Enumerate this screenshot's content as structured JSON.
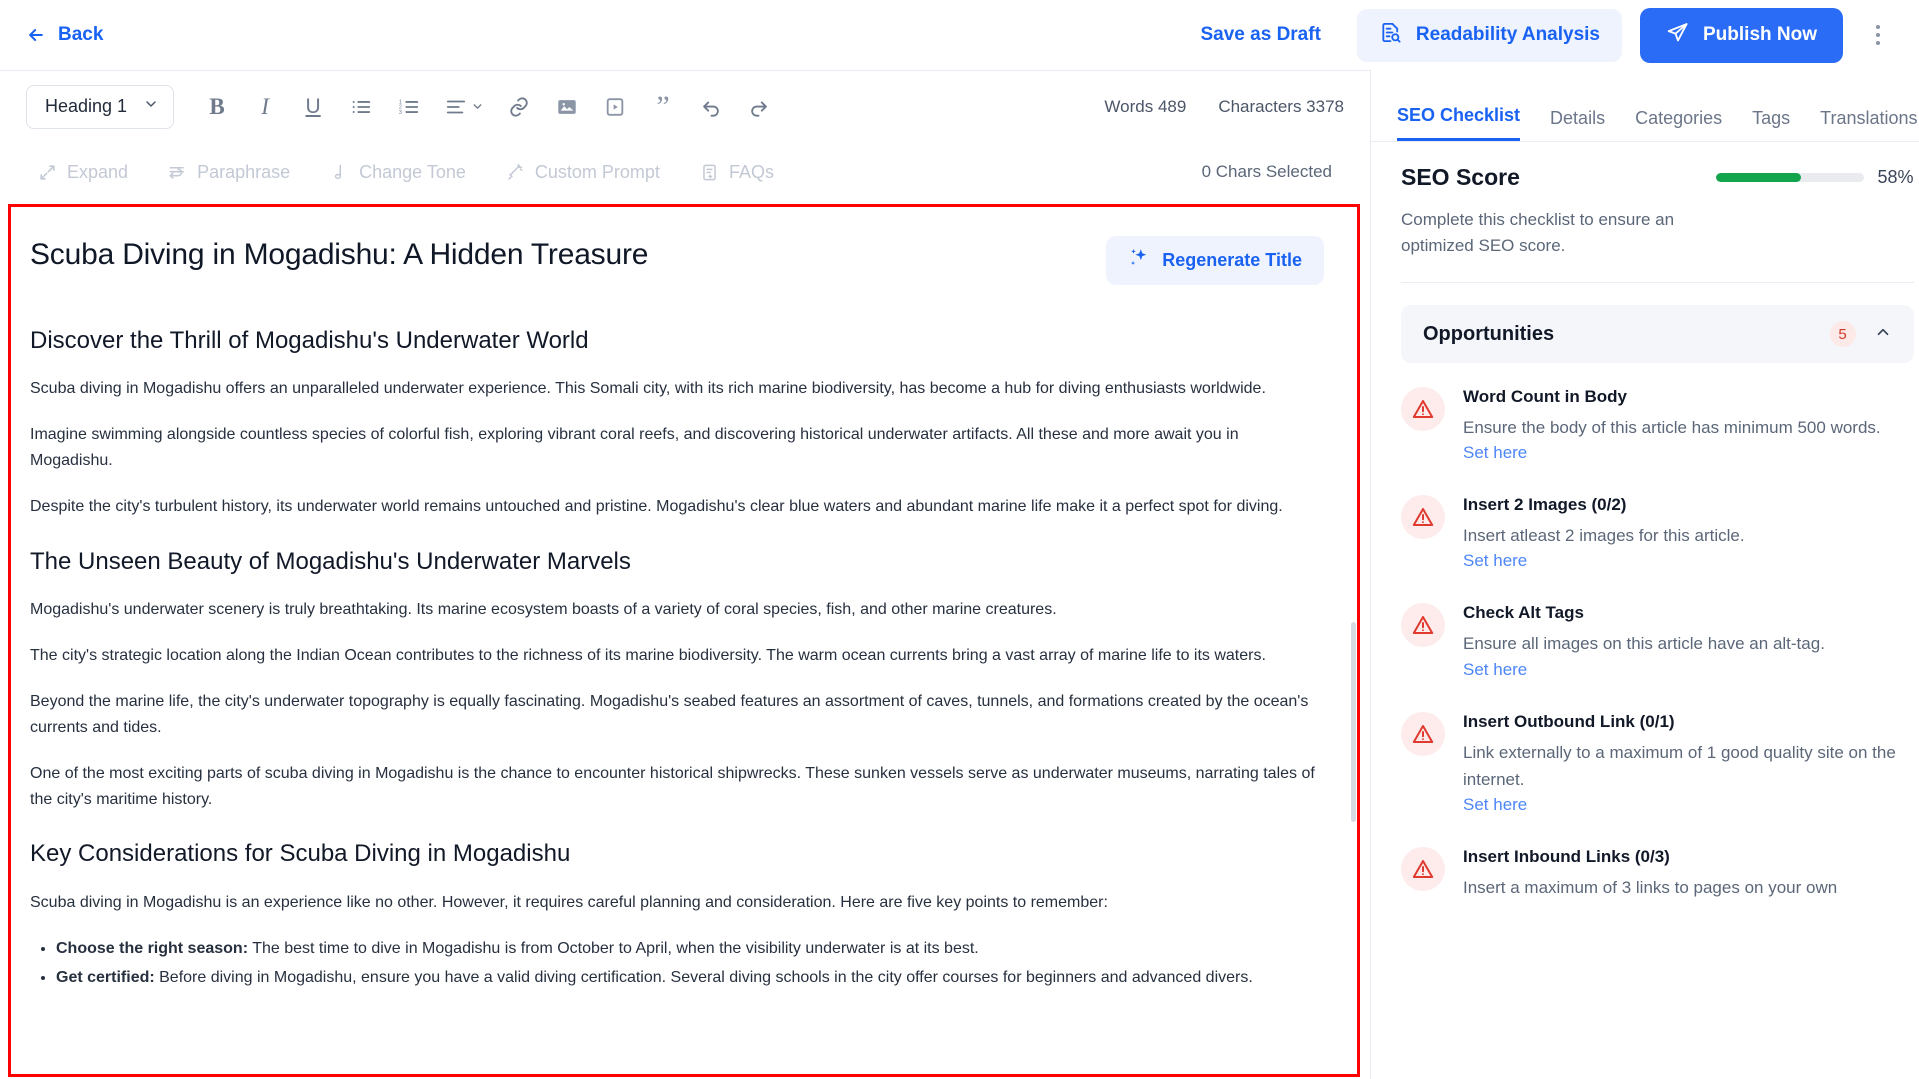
{
  "topbar": {
    "back_label": "Back",
    "save_draft_label": "Save as Draft",
    "readability_label": "Readability Analysis",
    "publish_label": "Publish Now"
  },
  "format_toolbar": {
    "heading_value": "Heading 1",
    "counts": {
      "words": "Words 489",
      "characters": "Characters 3378"
    },
    "buttons": [
      {
        "name": "bold-button",
        "label": "B"
      },
      {
        "name": "italic-button",
        "label": "I"
      },
      {
        "name": "underline-button",
        "label": "U"
      },
      {
        "name": "bullet-list-button",
        "label": "Bullet list"
      },
      {
        "name": "numbered-list-button",
        "label": "Numbered list"
      },
      {
        "name": "align-button",
        "label": "Align"
      },
      {
        "name": "link-button",
        "label": "Link"
      },
      {
        "name": "image-button",
        "label": "Image"
      },
      {
        "name": "video-button",
        "label": "Video"
      },
      {
        "name": "quote-button",
        "label": "Quote"
      },
      {
        "name": "undo-button",
        "label": "Undo"
      },
      {
        "name": "redo-button",
        "label": "Redo"
      }
    ]
  },
  "ai_toolbar": {
    "items": [
      {
        "label": "Expand",
        "icon": "expand-icon"
      },
      {
        "label": "Paraphrase",
        "icon": "paraphrase-icon"
      },
      {
        "label": "Change Tone",
        "icon": "tone-icon"
      },
      {
        "label": "Custom Prompt",
        "icon": "magic-wand-icon"
      },
      {
        "label": "FAQs",
        "icon": "faq-icon"
      }
    ],
    "chars_selected": "0 Chars Selected"
  },
  "editor": {
    "title": "Scuba Diving in Mogadishu: A Hidden Treasure",
    "regenerate_title_label": "Regenerate Title",
    "blocks": [
      {
        "type": "h2",
        "text": "Discover the Thrill of Mogadishu's Underwater World"
      },
      {
        "type": "p",
        "text": "Scuba diving in Mogadishu offers an unparalleled underwater experience. This Somali city, with its rich marine biodiversity, has become a hub for diving enthusiasts worldwide."
      },
      {
        "type": "p",
        "text": "Imagine swimming alongside countless species of colorful fish, exploring vibrant coral reefs, and discovering historical underwater artifacts. All these and more await you in Mogadishu."
      },
      {
        "type": "p",
        "text": "Despite the city's turbulent history, its underwater world remains untouched and pristine. Mogadishu's clear blue waters and abundant marine life make it a perfect spot for diving."
      },
      {
        "type": "h2",
        "text": "The Unseen Beauty of Mogadishu's Underwater Marvels"
      },
      {
        "type": "p",
        "text": "Mogadishu's underwater scenery is truly breathtaking. Its marine ecosystem boasts of a variety of coral species, fish, and other marine creatures."
      },
      {
        "type": "p",
        "text": "The city's strategic location along the Indian Ocean contributes to the richness of its marine biodiversity. The warm ocean currents bring a vast array of marine life to its waters."
      },
      {
        "type": "p",
        "text": "Beyond the marine life, the city's underwater topography is equally fascinating. Mogadishu's seabed features an assortment of caves, tunnels, and formations created by the ocean's currents and tides."
      },
      {
        "type": "p",
        "text": "One of the most exciting parts of scuba diving in Mogadishu is the chance to encounter historical shipwrecks. These sunken vessels serve as underwater museums, narrating tales of the city's maritime history."
      },
      {
        "type": "h2",
        "text": "Key Considerations for Scuba Diving in Mogadishu"
      },
      {
        "type": "p",
        "text": "Scuba diving in Mogadishu is an experience like no other. However, it requires careful planning and consideration. Here are five key points to remember:"
      }
    ],
    "list_items": [
      {
        "lead": "Choose the right season:",
        "text": " The best time to dive in Mogadishu is from October to April, when the visibility underwater is at its best."
      },
      {
        "lead": "Get certified:",
        "text": " Before diving in Mogadishu, ensure you have a valid diving certification. Several diving schools in the city offer courses for beginners and advanced divers."
      }
    ]
  },
  "sidebar": {
    "tabs": [
      {
        "label": "SEO Checklist",
        "active": true
      },
      {
        "label": "Details",
        "active": false
      },
      {
        "label": "Categories",
        "active": false
      },
      {
        "label": "Tags",
        "active": false
      },
      {
        "label": "Translations",
        "active": false
      }
    ],
    "seo_score_title": "SEO Score",
    "seo_score_percent": "58%",
    "seo_score_value": 58,
    "seo_score_color": "#14a54c",
    "seo_description": "Complete this checklist to ensure an optimized SEO score.",
    "opportunities": {
      "title": "Opportunities",
      "count": "5",
      "items": [
        {
          "title": "Word Count in Body",
          "description": "Ensure the body of this article has minimum 500 words.",
          "link": "Set here",
          "status": "warning"
        },
        {
          "title": "Insert 2 Images (0/2)",
          "description": "Insert atleast 2 images for this article.",
          "link": "Set here",
          "status": "warning"
        },
        {
          "title": "Check Alt Tags",
          "description": "Ensure all images on this article have an alt-tag.",
          "link": "Set here",
          "status": "warning"
        },
        {
          "title": "Insert Outbound Link (0/1)",
          "description": "Link externally to a maximum of 1 good quality site on the internet.",
          "link": "Set here",
          "status": "warning"
        },
        {
          "title": "Insert Inbound Links (0/3)",
          "description": "Insert a maximum of 3 links to pages on your own",
          "link": "",
          "status": "warning"
        }
      ]
    }
  },
  "colors": {
    "accent_blue": "#1a62f2",
    "publish_blue": "#2b6cf6",
    "warning_red": "#e03a2f",
    "success_green": "#14a54c",
    "highlight_outline": "#ff0000"
  }
}
